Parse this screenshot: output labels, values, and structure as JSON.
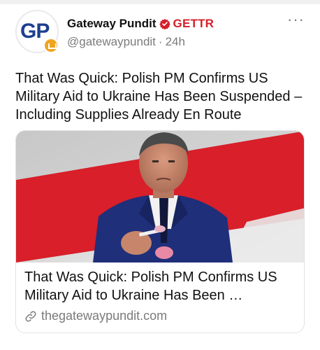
{
  "post": {
    "author": "Gateway Pundit",
    "network_label": "GETTR",
    "handle": "@gatewaypundit",
    "separator": "·",
    "time_ago": "24h",
    "text": "That Was Quick: Polish PM Confirms US Military Aid to Ukraine Has Been Suspended – Including Supplies Already En Route",
    "more_label": "···",
    "avatar_monogram": "GP"
  },
  "card": {
    "title": "That Was Quick: Polish PM Confirms US Military Aid to Ukraine Has Been …",
    "domain": "thegatewaypundit.com"
  },
  "colors": {
    "network_red": "#d4202b",
    "avatar_blue": "#1d3f8f",
    "badge_gold": "#f0a51f",
    "flag_red": "#d81f2a",
    "flag_white": "#ececec"
  },
  "icons": {
    "verified": "verified-check-icon",
    "more": "more-dots-icon",
    "link": "link-icon"
  }
}
